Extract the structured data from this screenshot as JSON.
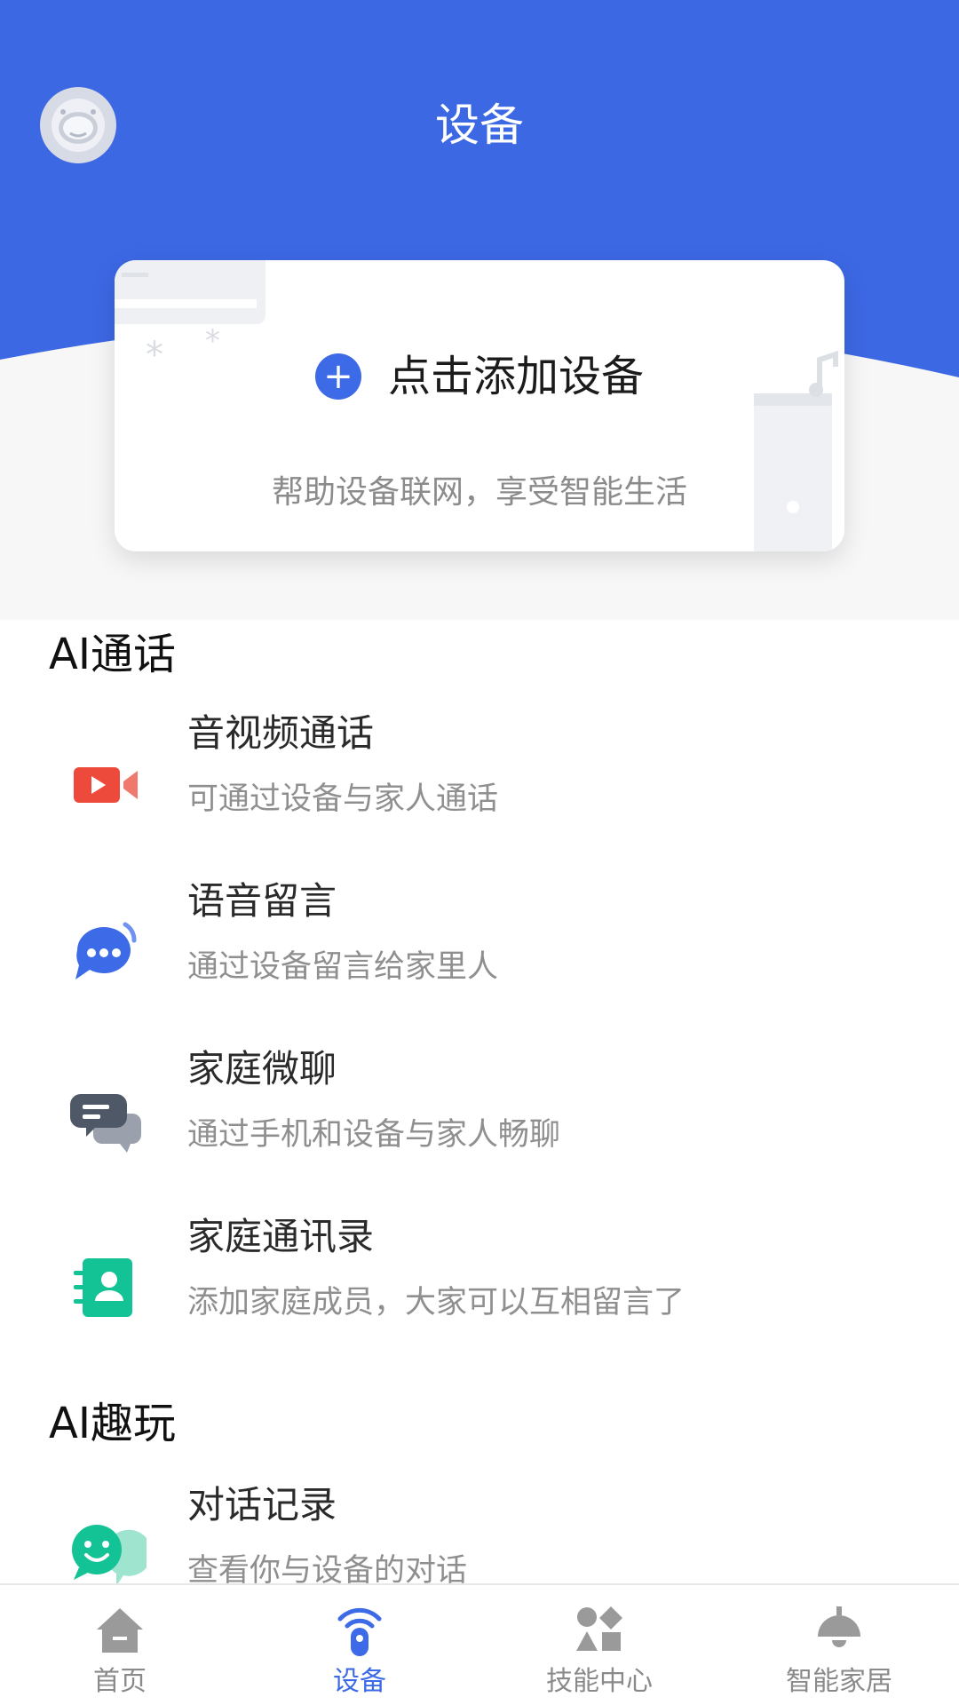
{
  "header": {
    "title": "设备",
    "avatar_icon": "astronaut-avatar-icon",
    "background_color": "#3d68e4"
  },
  "add_device_card": {
    "action_label": "点击添加设备",
    "subtitle": "帮助设备联网，享受智能生活",
    "accent_color": "#3d6ae6"
  },
  "sections": [
    {
      "title": "AI通话",
      "items": [
        {
          "title": "音视频通话",
          "desc": "可通过设备与家人通话",
          "icon": "video-call-icon",
          "color": "#ee4a3c"
        },
        {
          "title": "语音留言",
          "desc": "通过设备留言给家里人",
          "icon": "voice-message-icon",
          "color": "#3d6ae6"
        },
        {
          "title": "家庭微聊",
          "desc": "通过手机和设备与家人畅聊",
          "icon": "chat-bubbles-icon",
          "color": "#4f5866"
        },
        {
          "title": "家庭通讯录",
          "desc": "添加家庭成员，大家可以互相留言了",
          "icon": "contact-book-icon",
          "color": "#13c295"
        }
      ]
    },
    {
      "title": "AI趣玩",
      "items": [
        {
          "title": "对话记录",
          "desc": "查看你与设备的对话",
          "icon": "conversation-record-icon",
          "color": "#13c295"
        }
      ]
    }
  ],
  "bottom_nav": {
    "items": [
      {
        "label": "首页",
        "icon": "home-icon",
        "active": false
      },
      {
        "label": "设备",
        "icon": "device-icon",
        "active": true
      },
      {
        "label": "技能中心",
        "icon": "skills-icon",
        "active": false
      },
      {
        "label": "智能家居",
        "icon": "smart-home-icon",
        "active": false
      }
    ],
    "active_color": "#3d6ae6",
    "inactive_color": "#8a8a8a"
  }
}
